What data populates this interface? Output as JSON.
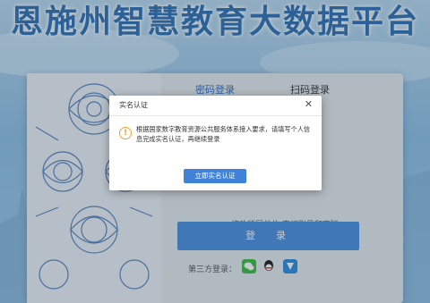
{
  "page": {
    "title": "恩施州智慧教育大数据平台"
  },
  "login": {
    "tab_password": "密码登录",
    "tab_scan": "扫码登录",
    "links": "修改所属单位 忘记账号和密码",
    "login_button": "登　录",
    "third_party_label": "第三方登录："
  },
  "dialog": {
    "title": "实名认证",
    "close_symbol": "✕",
    "message": "根据国家数字教育资源公共服务体系接入要求，请填写个人信息完成实名认证，再继续登录",
    "action_button": "立即实名认证",
    "icon": "warning-icon"
  },
  "social": [
    {
      "name": "wechat-icon",
      "color": "#3dbb3d"
    },
    {
      "name": "qq-icon",
      "color": "#1a1a1a"
    },
    {
      "name": "edu-app-icon",
      "color": "#2a8be0"
    }
  ],
  "colors": {
    "accent": "#3f82d8",
    "title": "#2f6fb3",
    "warning": "#e7a23a"
  }
}
